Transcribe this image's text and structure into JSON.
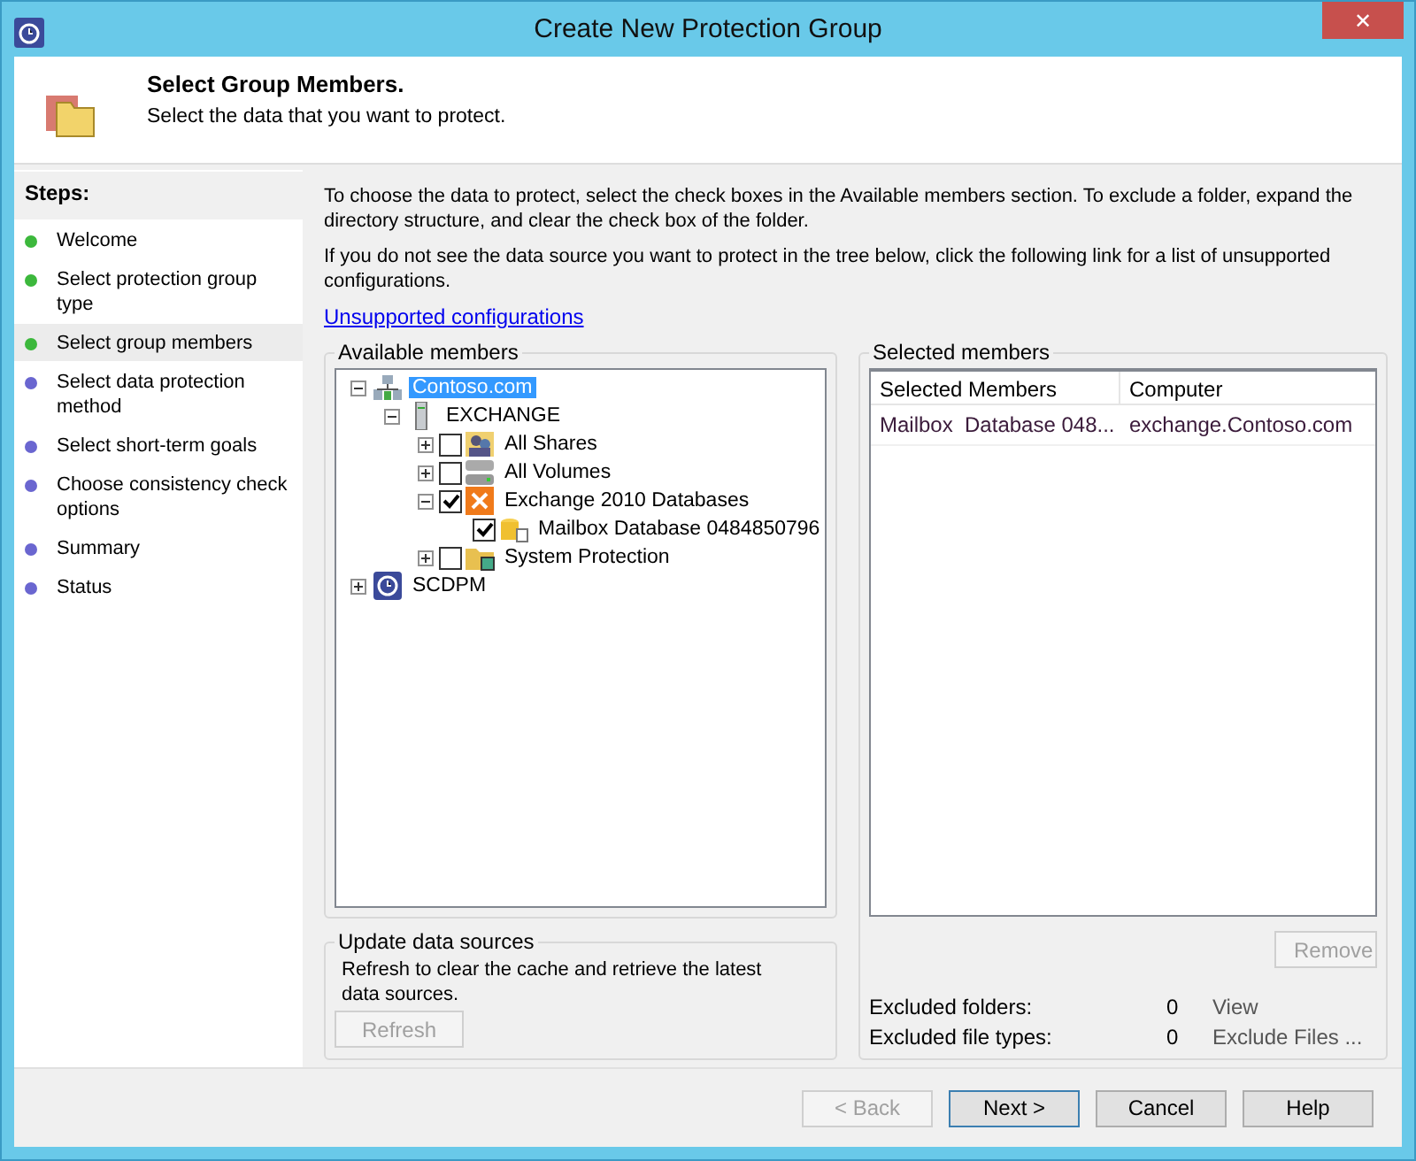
{
  "window": {
    "title": "Create New Protection Group",
    "close": "✕"
  },
  "header": {
    "title": "Select Group Members.",
    "subtitle": "Select the data that you want to protect."
  },
  "steps": {
    "title": "Steps:",
    "items": [
      {
        "label": "Welcome",
        "color": "#3cb83c",
        "selected": false
      },
      {
        "label": "Select protection group type",
        "color": "#3cb83c",
        "selected": false
      },
      {
        "label": "Select group members",
        "color": "#3cb83c",
        "selected": true
      },
      {
        "label": "Select data protection method",
        "color": "#6a66d0",
        "selected": false
      },
      {
        "label": "Select short-term goals",
        "color": "#6a66d0",
        "selected": false
      },
      {
        "label": "Choose consistency check options",
        "color": "#6a66d0",
        "selected": false
      },
      {
        "label": "Summary",
        "color": "#6a66d0",
        "selected": false
      },
      {
        "label": "Status",
        "color": "#6a66d0",
        "selected": false
      }
    ]
  },
  "intro": [
    "To choose the data to protect, select the check boxes in the Available members section. To exclude a folder, expand the directory structure, and clear the check box of the folder.",
    "If you do not see the data source you want to protect in the tree below, click the following link for a list of unsupported configurations."
  ],
  "link": "Unsupported configurations",
  "available": {
    "title": "Available members",
    "tree": [
      {
        "label": "Contoso.com",
        "kind": "domain",
        "expanded": true,
        "selected": true,
        "children": [
          {
            "label": "EXCHANGE",
            "kind": "server",
            "expanded": true,
            "selected": false,
            "children": [
              {
                "label": "All Shares",
                "kind": "shares",
                "expanded": false,
                "checked": false,
                "selected": false
              },
              {
                "label": "All Volumes",
                "kind": "volumes",
                "expanded": false,
                "checked": false,
                "selected": false
              },
              {
                "label": "Exchange 2010 Databases",
                "kind": "exchange",
                "expanded": true,
                "checked": true,
                "selected": false,
                "children": [
                  {
                    "label": "Mailbox Database 0484850796",
                    "kind": "database",
                    "checked": true,
                    "selected": false
                  }
                ]
              },
              {
                "label": "System Protection",
                "kind": "system",
                "expanded": false,
                "checked": false,
                "selected": false
              }
            ]
          }
        ]
      },
      {
        "label": "SCDPM",
        "kind": "dpm",
        "expanded": false,
        "selected": false
      }
    ]
  },
  "update": {
    "title": "Update data sources",
    "text": "Refresh to clear the cache and retrieve the latest data sources.",
    "button": {
      "label": "Refresh",
      "disabled": true
    }
  },
  "selected": {
    "title": "Selected members",
    "columns": [
      "Selected Members",
      "Computer"
    ],
    "rows": [
      [
        "Mailbox  Database 048...",
        "exchange.Contoso.com"
      ]
    ],
    "remove": {
      "label": "Remove",
      "disabled": true
    },
    "exclusions": [
      {
        "label": "Excluded folders:",
        "count": "0",
        "action": "View"
      },
      {
        "label": "Excluded file types:",
        "count": "0",
        "action": "Exclude Files ..."
      }
    ]
  },
  "buttons": [
    {
      "label": "< Back",
      "disabled": true,
      "default": false
    },
    {
      "label": "Next >",
      "disabled": false,
      "default": true
    },
    {
      "label": "Cancel",
      "disabled": false,
      "default": false
    },
    {
      "label": "Help",
      "disabled": false,
      "default": false
    }
  ]
}
